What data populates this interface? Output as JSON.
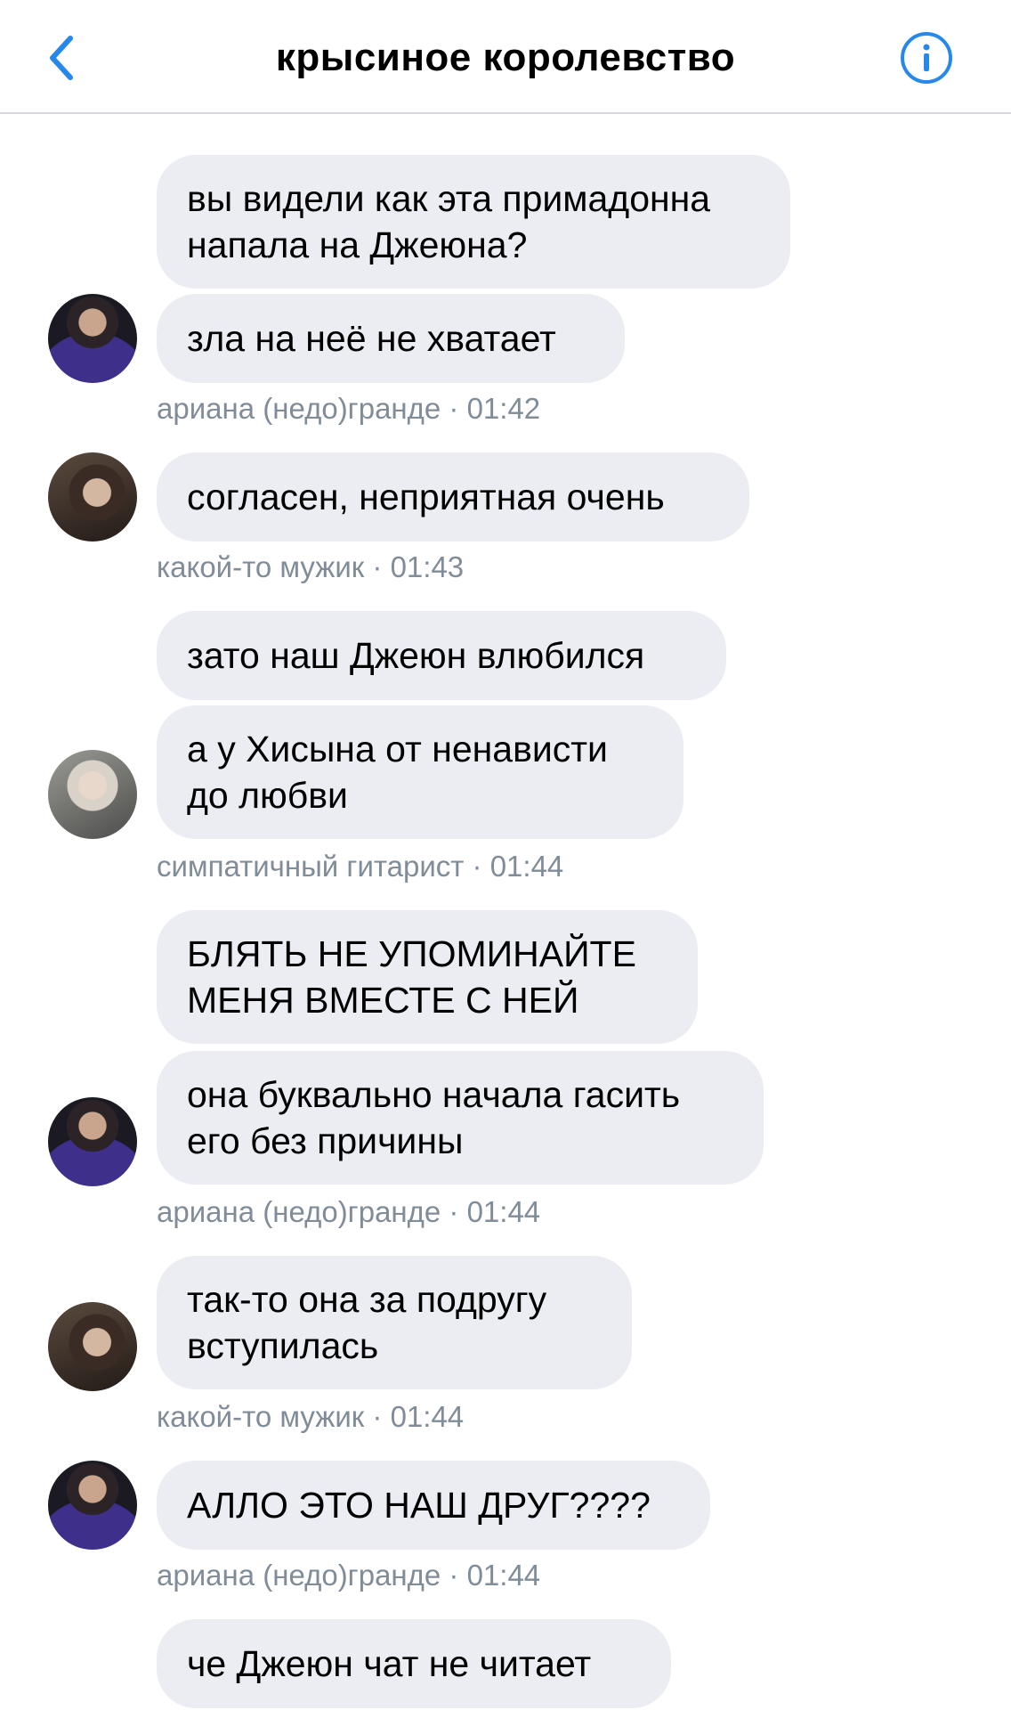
{
  "header": {
    "title": "крысиное королевство"
  },
  "messages": [
    {
      "text": [
        "вы видели как эта примадонна",
        "напала на Джеюна?"
      ]
    },
    {
      "text": [
        "зла на неё не хватает"
      ]
    },
    {
      "text": [
        "согласен, неприятная очень"
      ]
    },
    {
      "text": [
        "зато наш Джеюн влюбился"
      ]
    },
    {
      "text": [
        "а у Хисына от ненависти",
        "до любви"
      ]
    },
    {
      "text": [
        "БЛЯТЬ НЕ УПОМИНАЙТЕ",
        "МЕНЯ ВМЕСТЕ С НЕЙ"
      ]
    },
    {
      "text": [
        "она буквально начала гасить",
        "его без причины"
      ]
    },
    {
      "text": [
        "так-то она за подругу",
        "вступилась"
      ]
    },
    {
      "text": [
        "АЛЛО ЭТО НАШ ДРУГ????"
      ]
    },
    {
      "text": [
        "че Джеюн чат не читает"
      ]
    }
  ],
  "meta": [
    "ариана (недо)гранде  · 01:42",
    "какой-то мужик · 01:43",
    "симпатичный гитарист · 01:44",
    "ариана (недо)гранде  · 01:44",
    "какой-то мужик · 01:44",
    "ариана (недо)гранде  · 01:44"
  ],
  "colors": {
    "accent": "#2688eb",
    "bubble": "#ebedf3",
    "meta": "#818c99"
  },
  "icons": {
    "back": "chevron-left-icon",
    "info": "info-circle-icon"
  }
}
